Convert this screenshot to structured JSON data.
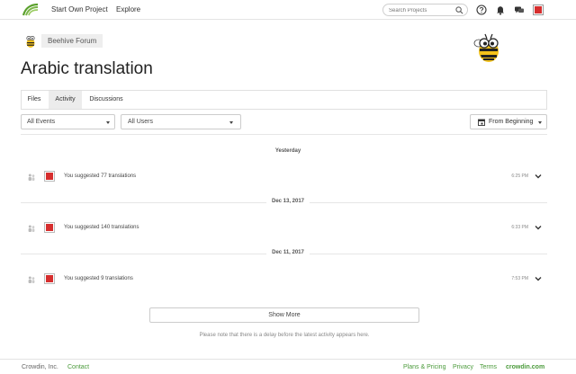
{
  "nav": {
    "logo_icon": "crowdin-logo-icon",
    "links": [
      "Start Own Project",
      "Explore"
    ],
    "search_placeholder": "Search Projects",
    "icons": [
      "help-icon",
      "bell-icon",
      "chat-icon",
      "avatar"
    ]
  },
  "project": {
    "name": "Beehive Forum",
    "title": "Arabic translation"
  },
  "tabs": [
    "Files",
    "Activity",
    "Discussions"
  ],
  "active_tab": "Activity",
  "filters": {
    "events": "All Events",
    "users": "All Users",
    "date": "From Beginning"
  },
  "activity": [
    {
      "date": "Yesterday",
      "text": "You suggested 77 translations",
      "time": "6:25 PM"
    },
    {
      "date": "Dec 13, 2017",
      "text": "You suggested 140 translations",
      "time": "6:33 PM"
    },
    {
      "date": "Dec 11, 2017",
      "text": "You suggested 9 translations",
      "time": "7:53 PM"
    }
  ],
  "show_more": "Show More",
  "note": "Please note that there is a delay before the latest activity appears here.",
  "footer": {
    "company": "Crowdin, Inc.",
    "contact": "Contact",
    "plans": "Plans & Pricing",
    "privacy": "Privacy",
    "terms": "Terms",
    "brand": "crowdin.com"
  },
  "colors": {
    "brand_green": "#4a9a3a",
    "avatar_red": "#d62e2e"
  }
}
